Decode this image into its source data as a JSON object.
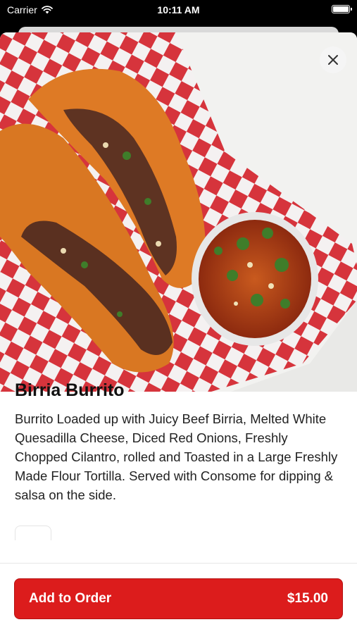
{
  "status_bar": {
    "carrier": "Carrier",
    "time": "10:11 AM",
    "battery_level": 1.0
  },
  "item": {
    "title": "Birria Burrito",
    "description": "Burrito Loaded up with Juicy Beef Birria, Melted White Quesadilla Cheese, Diced Red Onions, Freshly Chopped Cilantro, rolled and Toasted in a Large Freshly Made Flour Tortilla. Served with Consome for dipping & salsa on the side."
  },
  "footer": {
    "add_label": "Add to Order",
    "price": "$15.00"
  },
  "colors": {
    "accent": "#dc1c1c",
    "text": "#111111"
  },
  "icons": {
    "close": "close-icon",
    "wifi": "wifi-icon",
    "battery": "battery-icon"
  }
}
